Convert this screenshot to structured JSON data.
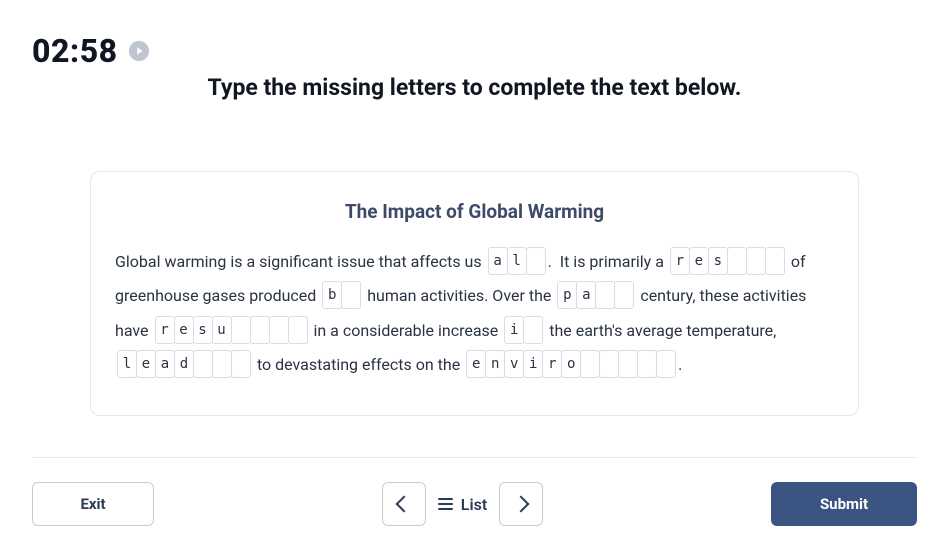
{
  "timer": "02:58",
  "instruction": "Type the missing letters to complete the text below.",
  "card": {
    "title": "The Impact of Global Warming",
    "segments": [
      {
        "type": "text",
        "value": "Global warming is a significant issue that affects us "
      },
      {
        "type": "gap",
        "prefill": "al",
        "blanks": 1
      },
      {
        "type": "text",
        "value": ".  It is primarily a "
      },
      {
        "type": "gap",
        "prefill": "res",
        "blanks": 3
      },
      {
        "type": "text",
        "value": " of greenhouse gases produced "
      },
      {
        "type": "gap",
        "prefill": "b",
        "blanks": 1
      },
      {
        "type": "text",
        "value": " human activities. Over the "
      },
      {
        "type": "gap",
        "prefill": "pa",
        "blanks": 2
      },
      {
        "type": "text",
        "value": " century, these activities have "
      },
      {
        "type": "gap",
        "prefill": "resu",
        "blanks": 4
      },
      {
        "type": "text",
        "value": " in a considerable increase "
      },
      {
        "type": "gap",
        "prefill": "i",
        "blanks": 1
      },
      {
        "type": "text",
        "value": " the earth's average temperature, "
      },
      {
        "type": "gap",
        "prefill": "lead",
        "blanks": 3
      },
      {
        "type": "text",
        "value": " to devastating effects on the "
      },
      {
        "type": "gap",
        "prefill": "enviro",
        "blanks": 5
      },
      {
        "type": "text",
        "value": "."
      }
    ]
  },
  "footer": {
    "exit": "Exit",
    "list": "List",
    "submit": "Submit"
  }
}
